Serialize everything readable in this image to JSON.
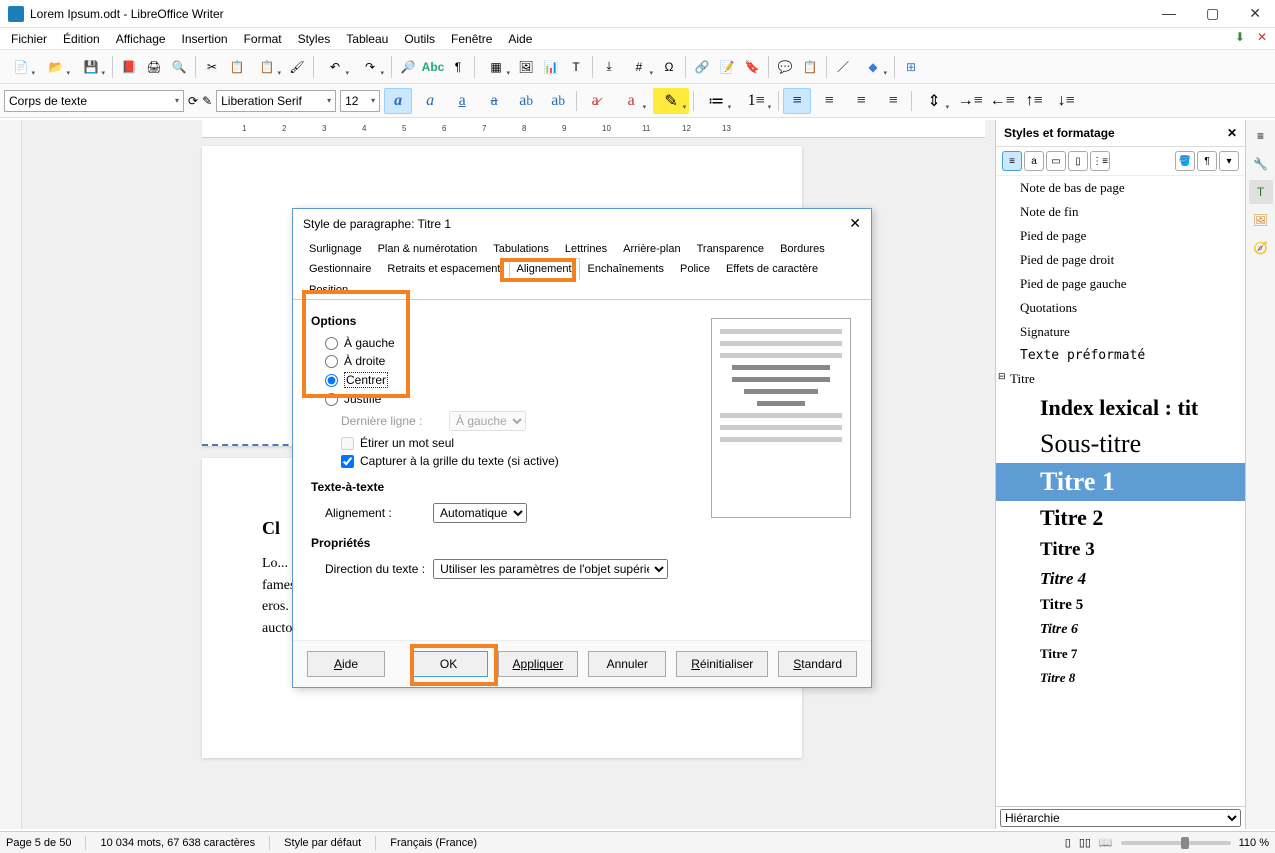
{
  "window": {
    "title": "Lorem Ipsum.odt - LibreOffice Writer"
  },
  "menubar": [
    "Fichier",
    "Édition",
    "Affichage",
    "Insertion",
    "Format",
    "Styles",
    "Tableau",
    "Outils",
    "Fenêtre",
    "Aide"
  ],
  "format": {
    "para_style": "Corps de texte",
    "font_name": "Liberation Serif",
    "font_size": "12"
  },
  "doc": {
    "heading": "Cl",
    "body": "Lo...           ...el...           Pellentesque habitant morbi tristique senectus et netus et malesuada fames ac turpis egestas. Proin quis justo interdum, aliquam dolor vitae, consectetur eros. Sed ut congue purus, eleifend lacinia tortor. Vestibulum suscipit varius metus id auctor. Sed venenatis vehicula orci in tincidunt. Nullam ante"
  },
  "dialog": {
    "title": "Style de paragraphe: Titre 1",
    "tabs_row1": [
      "Surlignage",
      "Plan & numérotation",
      "Tabulations",
      "Lettrines",
      "Arrière-plan",
      "Transparence",
      "Bordures"
    ],
    "tabs_row2": [
      "Gestionnaire",
      "Retraits et espacement",
      "Alignement",
      "Enchaînements",
      "Police",
      "Effets de caractère",
      "Position"
    ],
    "active_tab": "Alignement",
    "groups": {
      "options": "Options",
      "text_to_text": "Texte-à-texte",
      "props": "Propriétés"
    },
    "radios": {
      "left": "À gauche",
      "right": "À droite",
      "center": "Centrer",
      "justify": "Justifié"
    },
    "last_line_label": "Dernière ligne :",
    "last_line_value": "À gauche",
    "expand_word": "Étirer un mot seul",
    "snap_grid": "Capturer à la grille du texte (si active)",
    "align_label": "Alignement :",
    "align_value": "Automatique",
    "dir_label": "Direction du texte :",
    "dir_value": "Utiliser les paramètres de l'objet supérieur",
    "buttons": {
      "help": "Aide",
      "ok": "OK",
      "apply": "Appliquer",
      "cancel": "Annuler",
      "reset": "Réinitialiser",
      "standard": "Standard"
    }
  },
  "styles_panel": {
    "title": "Styles et formatage",
    "items": [
      {
        "label": "Note de bas de page",
        "cls": ""
      },
      {
        "label": "Note de fin",
        "cls": ""
      },
      {
        "label": "Pied de page",
        "cls": ""
      },
      {
        "label": "Pied de page droit",
        "cls": ""
      },
      {
        "label": "Pied de page gauche",
        "cls": ""
      },
      {
        "label": "Quotations",
        "cls": ""
      },
      {
        "label": "Signature",
        "cls": ""
      },
      {
        "label": "Texte préformaté",
        "cls": "mono"
      }
    ],
    "titre_parent": "Titre",
    "children": [
      {
        "label": "Index lexical : tit",
        "cls": "big1"
      },
      {
        "label": "Sous-titre",
        "cls": "big2"
      },
      {
        "label": "Titre 1",
        "cls": "h1",
        "selected": true
      },
      {
        "label": "Titre 2",
        "cls": "h2"
      },
      {
        "label": "Titre 3",
        "cls": "h3"
      },
      {
        "label": "Titre 4",
        "cls": "h4"
      },
      {
        "label": "Titre 5",
        "cls": "h5"
      },
      {
        "label": "Titre 6",
        "cls": "h6"
      },
      {
        "label": "Titre 7",
        "cls": "h7"
      },
      {
        "label": "Titre 8",
        "cls": "h8"
      }
    ],
    "footer_combo": "Hiérarchie"
  },
  "statusbar": {
    "page": "Page 5 de 50",
    "words": "10 034 mots, 67 638 caractères",
    "style": "Style par défaut",
    "lang": "Français (France)",
    "zoom": "110 %"
  },
  "ruler_ticks": [
    "1",
    "2",
    "3",
    "4",
    "5",
    "6",
    "7",
    "8",
    "9",
    "10",
    "11",
    "12",
    "13"
  ]
}
